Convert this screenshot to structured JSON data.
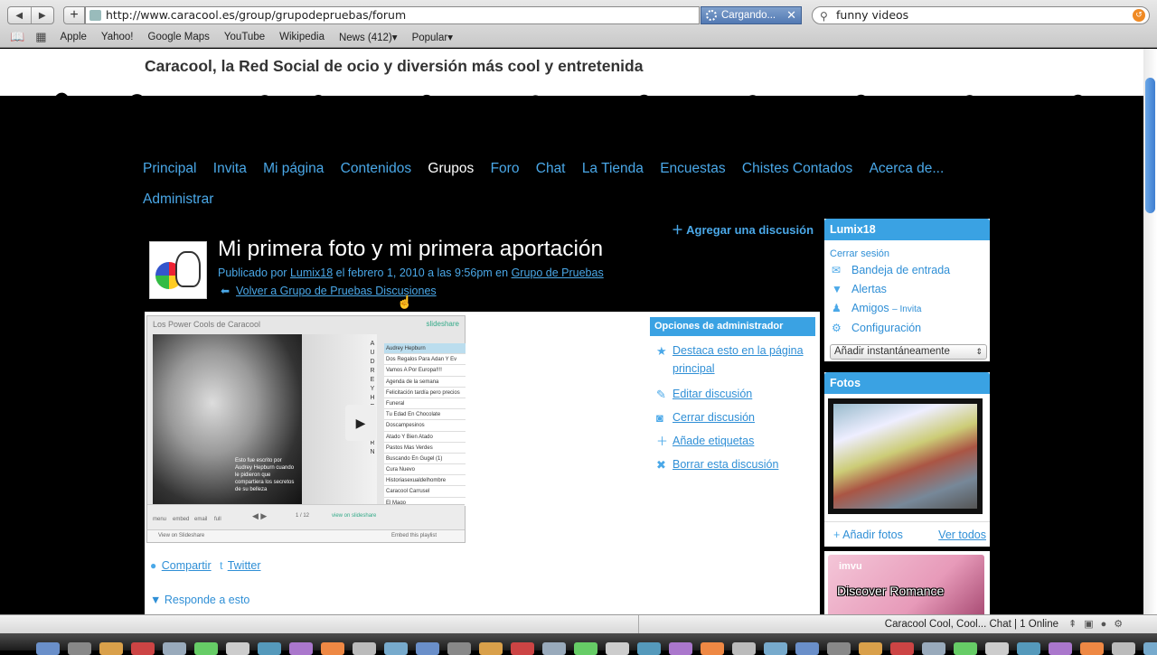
{
  "browser": {
    "url": "http://www.caracool.es/group/grupodepruebas/forum",
    "loading_label": "Cargando...",
    "search_value": "funny videos",
    "bookmarks": [
      "Apple",
      "Yahoo!",
      "Google Maps",
      "YouTube",
      "Wikipedia",
      "News (412)▾",
      "Popular▾"
    ],
    "status_text": "Caracool Cool, Cool... Chat | 1 Online"
  },
  "site": {
    "tagline": "Caracool, la Red Social de ocio y diversión más cool y entretenida",
    "nav": [
      "Principal",
      "Invita",
      "Mi página",
      "Contenidos",
      "Grupos",
      "Foro",
      "Chat",
      "La Tienda",
      "Encuestas",
      "Chistes Contados",
      "Acerca de...",
      "Administrar"
    ],
    "nav_active": "Grupos"
  },
  "post": {
    "add_discussion": "Agregar una discusión",
    "title": "Mi primera foto y mi primera aportación",
    "meta_prefix": "Publicado por",
    "author": "Lumix18",
    "meta_date": "el febrero 1, 2010 a las 9:56pm en",
    "group": "Grupo de Pruebas",
    "back_link": "Volver a Grupo de Pruebas Discusiones",
    "share_label": "Compartir",
    "twitter_label": "Twitter",
    "reply_label": "Responde a esto"
  },
  "slideshare": {
    "title": "Los Power Cools de Caracool",
    "brand": "slideshare",
    "vertical_name": "AUDREY HEPBURN",
    "caption": "Esto fue escrito por Audrey Hepburn cuando le pidieron que compartiera los secretos de su belleza",
    "playlist": [
      "Audrey Hepburn",
      "Dos Regalos Para Adan Y Ev",
      "Vamos A Por Europa!!!!",
      "Agenda de la semana",
      "Felicitación tardía pero precios",
      "Funeral",
      "Tu Edad En Chocolate",
      "Doscampesinos",
      "Atado Y Bien Atado",
      "Pastos Mas Verdes",
      "Buscando En Gugel (1)",
      "Cura Nuevo",
      "Historiasexualdelhombre",
      "Caracool Carrusel",
      "El Mago"
    ],
    "controls": [
      "menu",
      "embed",
      "email",
      "full"
    ],
    "page_indicator": "1 / 12",
    "view_on": "view on slideshare",
    "footer_left": "View on Slideshare",
    "footer_right": "Embed this playlist"
  },
  "admin": {
    "header": "Opciones de administrador",
    "items": [
      "Destaca esto en la página principal",
      "Editar discusión",
      "Cerrar discusión",
      "Añade etiquetas",
      "Borrar esta discusión"
    ]
  },
  "sidebar": {
    "user": {
      "name": "Lumix18",
      "logout": "Cerrar sesión",
      "inbox": "Bandeja de entrada",
      "alerts": "Alertas",
      "friends": "Amigos",
      "invite": "– Invita",
      "settings": "Configuración",
      "quick_add": "Añadir instantáneamente"
    },
    "photos": {
      "header": "Fotos",
      "add": "Añadir fotos",
      "view_all": "Ver todos"
    },
    "ad": {
      "brand": "imvu",
      "text": "Discover Romance"
    }
  }
}
